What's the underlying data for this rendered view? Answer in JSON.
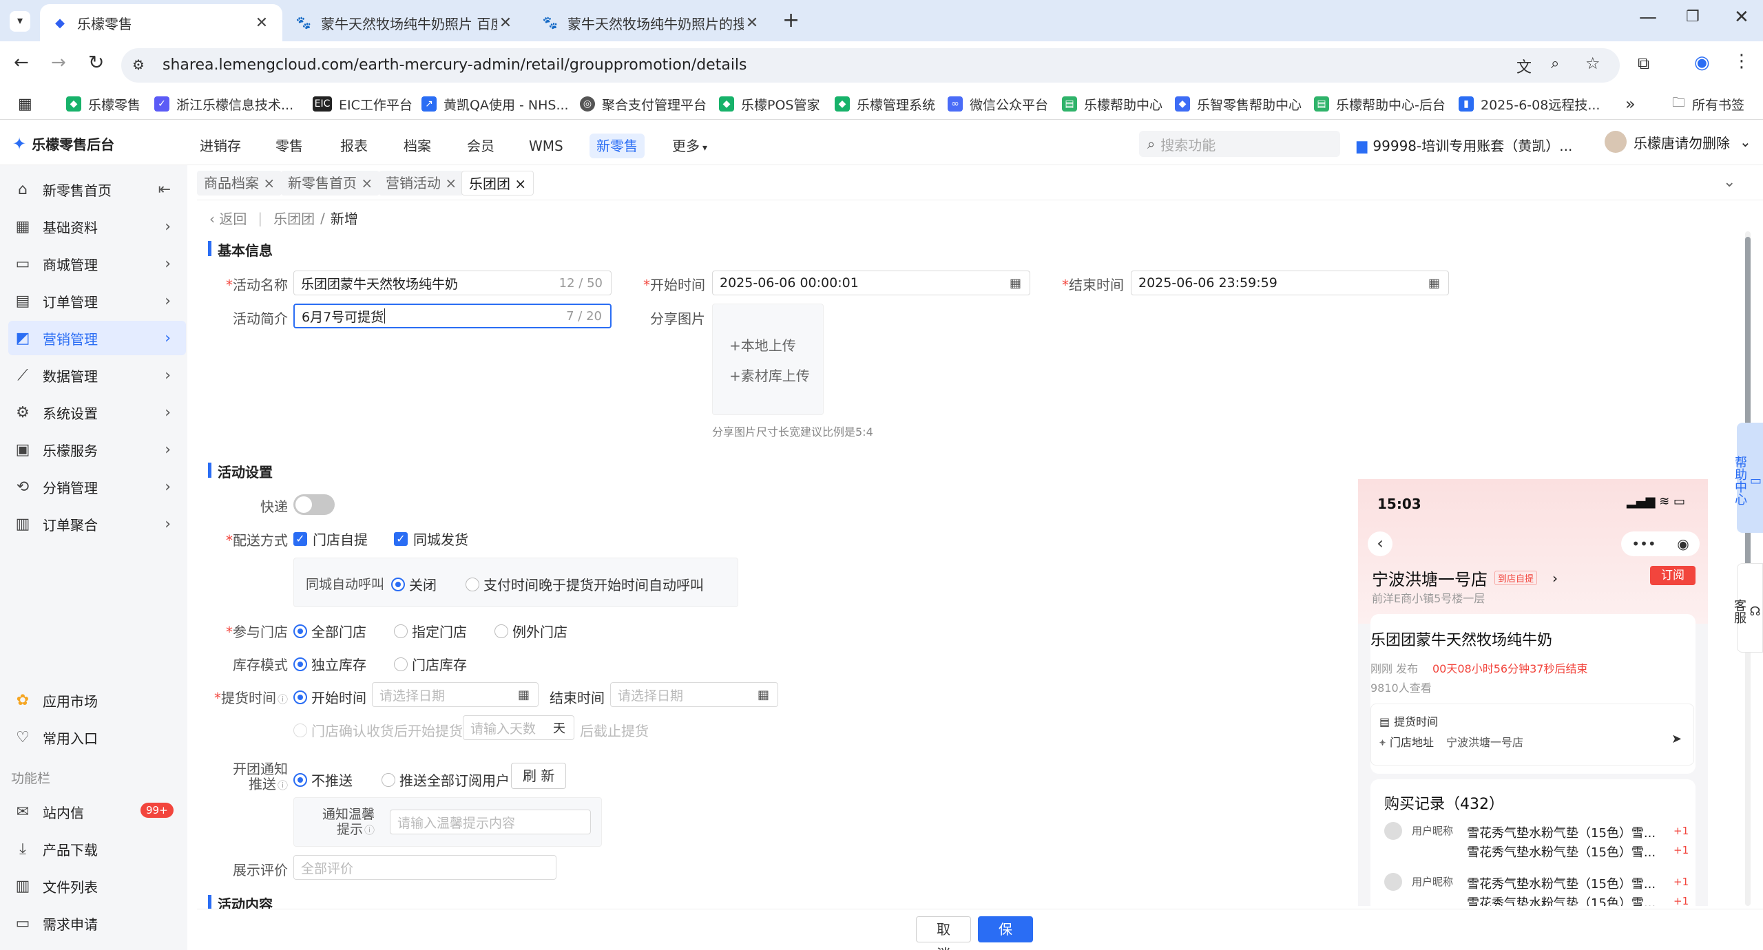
{
  "browser": {
    "tabs": [
      {
        "title": "乐檬零售",
        "active": true
      },
      {
        "title": "蒙牛天然牧场纯牛奶照片 百度",
        "active": false
      },
      {
        "title": "蒙牛天然牧场纯牛奶照片的搜索",
        "active": false
      }
    ],
    "url": "sharea.lemengcloud.com/earth-mercury-admin/retail/grouppromotion/details",
    "bookmarks": [
      "乐檬零售",
      "浙江乐檬信息技术...",
      "EIC工作平台",
      "黄凯QA使用 - NHS...",
      "聚合支付管理平台",
      "乐檬POS管家",
      "乐檬管理系统",
      "微信公众平台",
      "乐檬帮助中心",
      "乐智零售帮助中心",
      "乐檬帮助中心-后台",
      "2025-6-08远程技..."
    ],
    "all_bookmarks": "所有书签"
  },
  "app": {
    "logo": "乐檬零售后台",
    "nav": [
      "进销存",
      "零售",
      "报表",
      "档案",
      "会员",
      "WMS",
      "新零售",
      "更多"
    ],
    "active_nav": "新零售",
    "search_placeholder": "搜索功能",
    "account": "99998-培训专用账套（黄凯）...",
    "user": "乐檬唐请勿删除"
  },
  "sidebar": {
    "items": [
      "新零售首页",
      "基础资料",
      "商城管理",
      "订单管理",
      "营销管理",
      "数据管理",
      "系统设置",
      "乐檬服务",
      "分销管理",
      "订单聚合"
    ],
    "active": "营销管理",
    "bottom": [
      "应用市场",
      "常用入口"
    ],
    "section": "功能栏",
    "tools": [
      "站内信",
      "产品下载",
      "文件列表",
      "需求申请"
    ],
    "badge": "99+"
  },
  "page_tags": [
    "商品档案",
    "新零售首页",
    "营销活动",
    "乐团团"
  ],
  "breadcrumb": {
    "back": "返回",
    "parent": "乐团团",
    "current": "新增"
  },
  "basic": {
    "title": "基本信息",
    "name_label": "活动名称",
    "name_value": "乐团团蒙牛天然牧场纯牛奶",
    "name_count": "12 / 50",
    "intro_label": "活动简介",
    "intro_value": "6月7号可提货",
    "intro_count": "7 / 20",
    "start_label": "开始时间",
    "start_value": "2025-06-06 00:00:01",
    "end_label": "结束时间",
    "end_value": "2025-06-06 23:59:59",
    "share_label": "分享图片",
    "upload_local": "+本地上传",
    "upload_lib": "+素材库上传",
    "share_hint": "分享图片尺寸长宽建议比例是5:4"
  },
  "settings": {
    "title": "活动设置",
    "express_label": "快递",
    "delivery_label": "配送方式",
    "delivery_opts": [
      "门店自提",
      "同城发货"
    ],
    "auto_call_label": "同城自动呼叫",
    "auto_call_opts": [
      "关闭",
      "支付时间晚于提货开始时间自动呼叫"
    ],
    "stores_label": "参与门店",
    "stores_opts": [
      "全部门店",
      "指定门店",
      "例外门店"
    ],
    "stock_label": "库存模式",
    "stock_opts": [
      "独立库存",
      "门店库存"
    ],
    "pickup_label": "提货时间",
    "pickup_start": "开始时间",
    "pickup_start_ph": "请选择日期",
    "pickup_end": "结束时间",
    "pickup_end_ph": "请选择日期",
    "pickup_confirm": "门店确认收货后开始提货",
    "pickup_days_ph": "请输入天数",
    "pickup_days_unit": "天",
    "pickup_after": "后截止提货",
    "notify_label_1": "开团通知",
    "notify_label_2": "推送",
    "notify_opts": [
      "不推送",
      "推送全部订阅用户"
    ],
    "refresh": "刷 新",
    "tip_label_1": "通知温馨",
    "tip_label_2": "提示",
    "tip_ph": "请输入温馨提示内容",
    "review_label": "展示评价",
    "review_ph": "全部评价"
  },
  "content_title": "活动内容",
  "footer": {
    "cancel": "取 消",
    "save": "保 存"
  },
  "side_float": {
    "help": "帮助中心",
    "service": "客服"
  },
  "preview": {
    "time": "15:03",
    "store": "宁波洪塘一号店",
    "store_tag": "到店自提",
    "subscribe": "订阅",
    "address": "前洋E商小镇5号楼一层",
    "product": "乐团团蒙牛天然牧场纯牛奶",
    "publish": "刚刚 发布",
    "countdown": "00天08小时56分钟37秒后结束",
    "views": "9810人查看",
    "pickup_time": "提货时间",
    "store_addr_label": "门店地址",
    "store_addr": "宁波洪塘一号店",
    "records_title": "购买记录（432）",
    "user": "用户昵称",
    "item": "雪花秀气垫水粉气垫（15色）雪...",
    "qty": "+1"
  },
  "colors": {
    "accent": "#2a6df4",
    "danger": "#f2453d"
  }
}
